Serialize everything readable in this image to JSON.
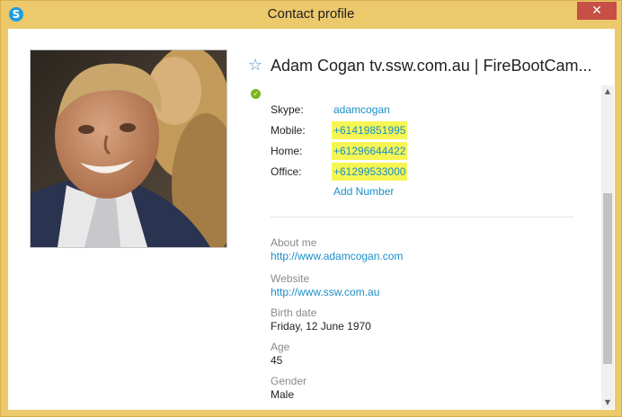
{
  "window": {
    "title": "Contact profile",
    "close_glyph": "✕"
  },
  "contact": {
    "name": "Adam Cogan tv.ssw.com.au | FireBootCam...",
    "presence": "online",
    "phones": [
      {
        "label": "Skype:",
        "value": "adamcogan"
      },
      {
        "label": "Mobile:",
        "value": "+61419851995"
      },
      {
        "label": "Home:",
        "value": "+61296644422"
      },
      {
        "label": "Office:",
        "value": "+61299533000"
      }
    ],
    "add_number_label": "Add Number"
  },
  "details": {
    "about_me": {
      "label": "About me",
      "value": "http://www.adamcogan.com"
    },
    "website": {
      "label": "Website",
      "value": "http://www.ssw.com.au"
    },
    "birth_date": {
      "label": "Birth date",
      "value": "Friday, 12 June 1970"
    },
    "age": {
      "label": "Age",
      "value": "45"
    },
    "gender": {
      "label": "Gender",
      "value": "Male"
    }
  },
  "colors": {
    "title_bar": "#ecc96b",
    "link": "#1a8fc8",
    "highlight": "#f6f653",
    "close_button": "#c74f45",
    "presence_online": "#7ab51d"
  },
  "icons": {
    "app": "skype-icon",
    "favorite": "star-icon",
    "presence": "online-status-icon",
    "close": "close-icon"
  }
}
